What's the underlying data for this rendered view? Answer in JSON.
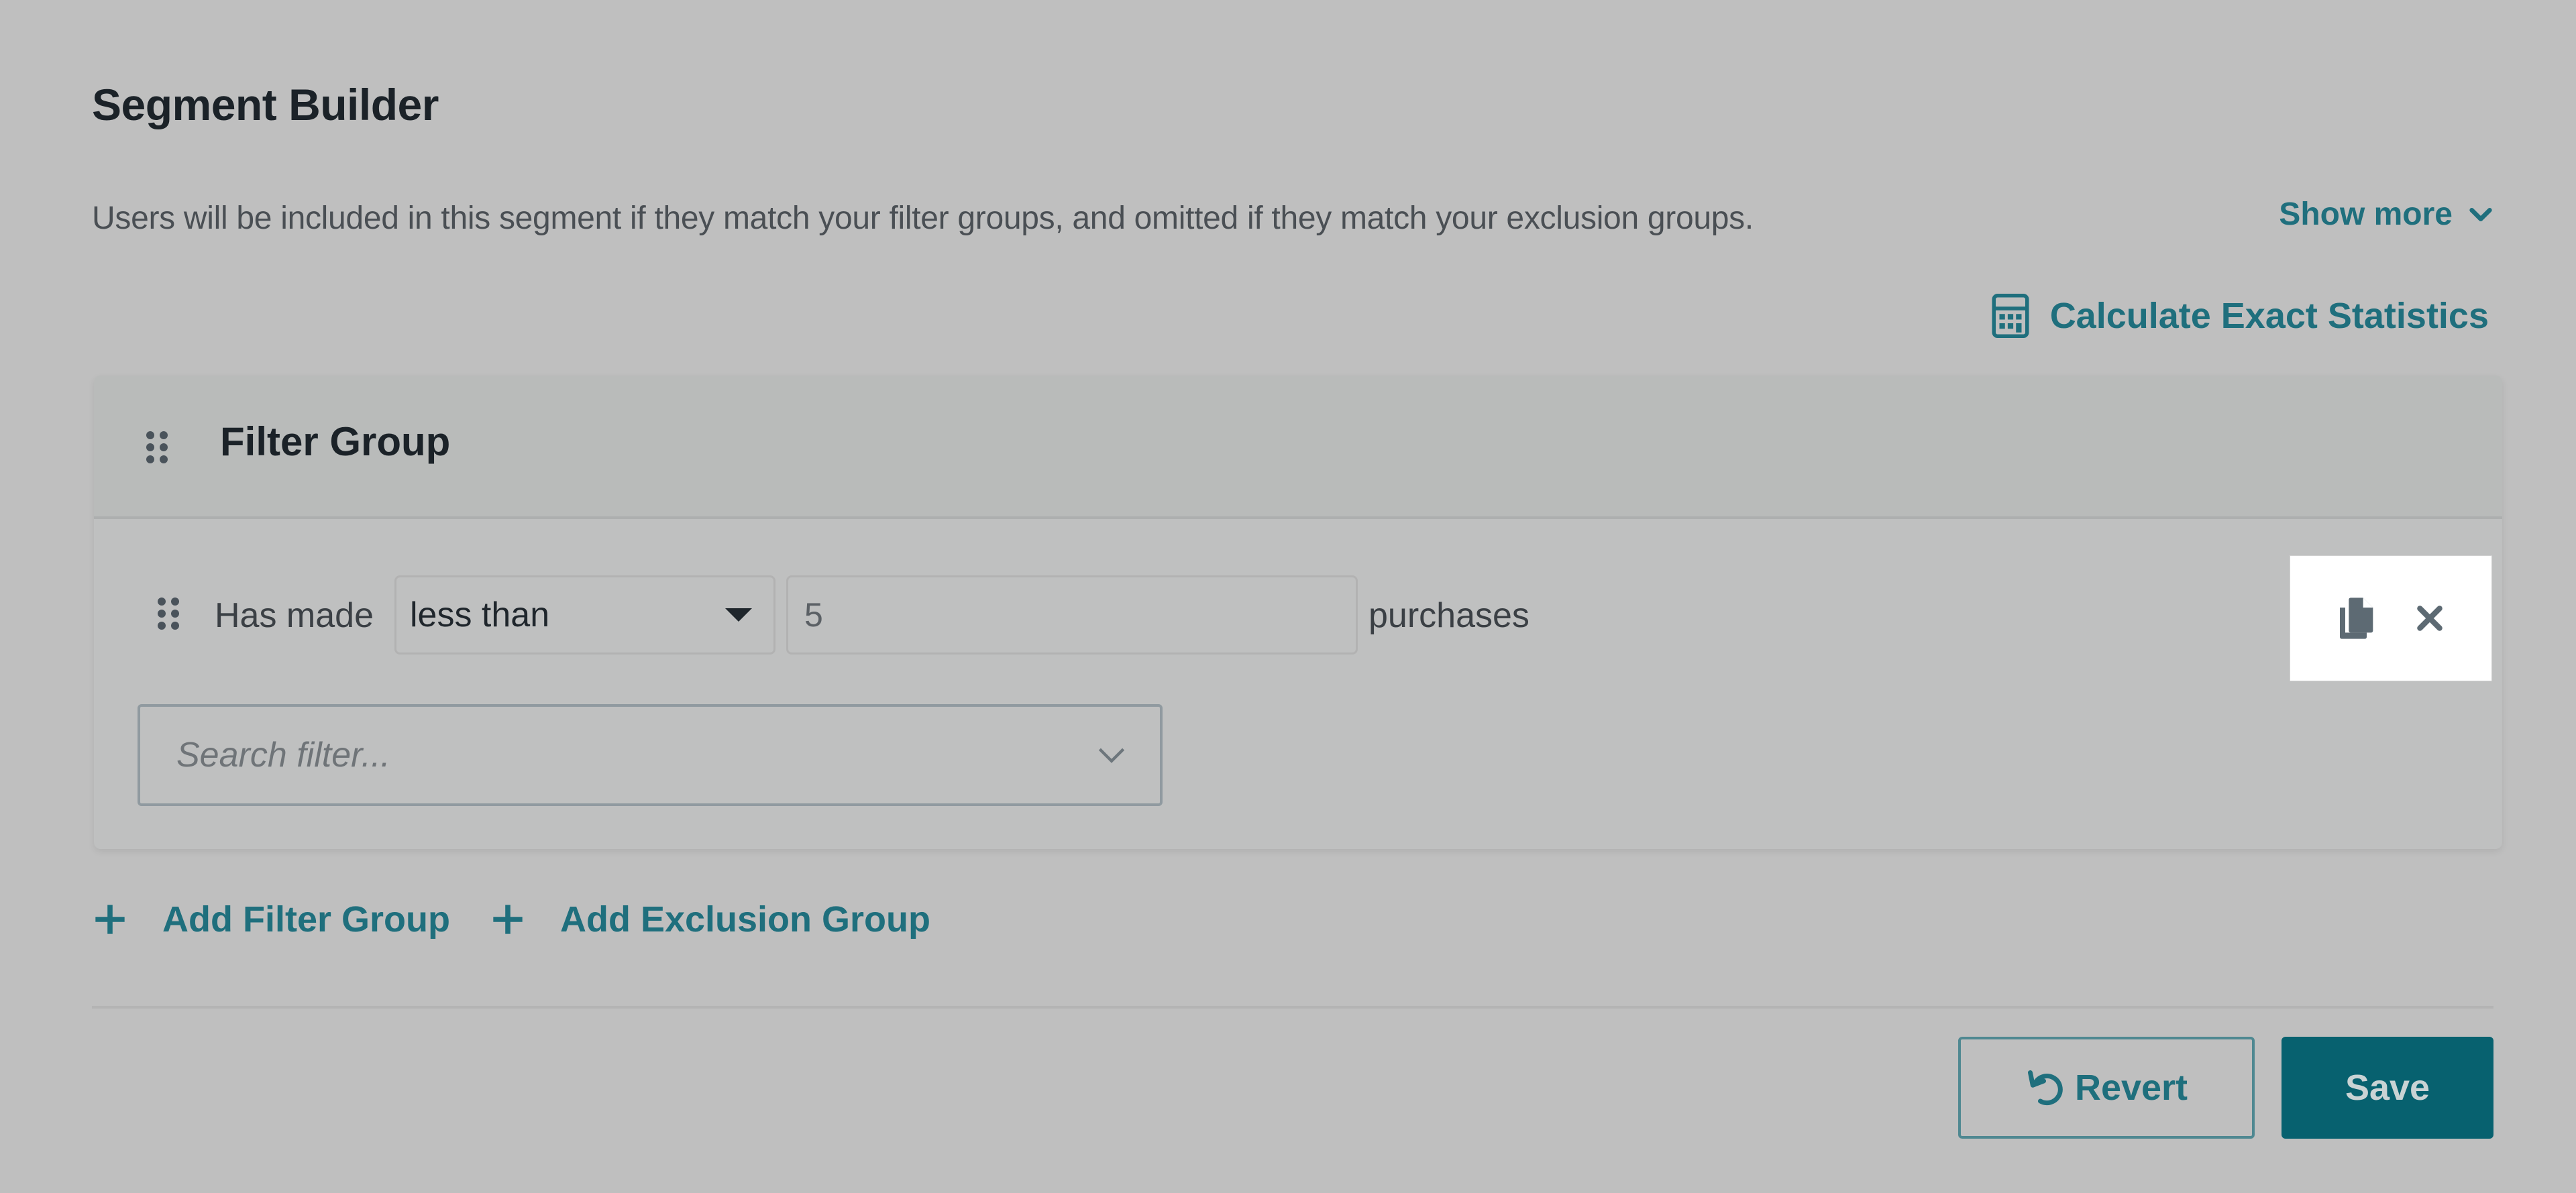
{
  "page": {
    "title": "Segment Builder",
    "description": "Users will be included in this segment if they match your filter groups, and omitted if they match your exclusion groups.",
    "show_more_label": "Show more",
    "calculate_label": "Calculate Exact Statistics"
  },
  "filter_group": {
    "title": "Filter Group",
    "condition": {
      "prefix": "Has made",
      "operator": "less than",
      "value": "5",
      "suffix": "purchases"
    },
    "search_placeholder": "Search filter..."
  },
  "actions": {
    "copy_icon": "copy-icon",
    "close_icon": "close-icon"
  },
  "add_links": {
    "add_filter_group": "Add Filter Group",
    "add_exclusion_group": "Add Exclusion Group"
  },
  "footer": {
    "revert_label": "Revert",
    "save_label": "Save"
  },
  "colors": {
    "accent": "#1f6f7d",
    "save_bg": "#07616f",
    "overlay": "#bfbfbf",
    "icon_gray": "#5d6a73"
  }
}
